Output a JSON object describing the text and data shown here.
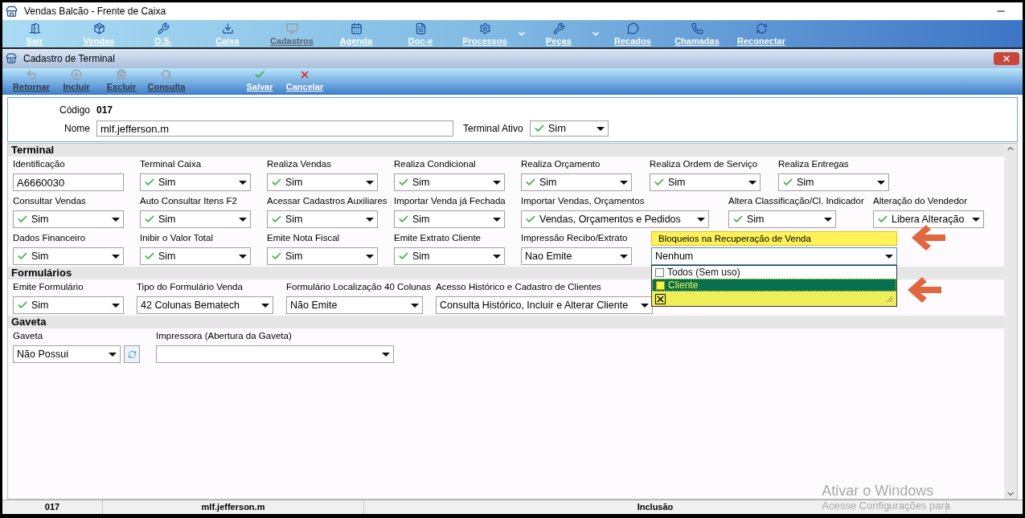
{
  "app": {
    "title": "Vendas Balcão - Frente de Caixa"
  },
  "main_toolbar": [
    {
      "label": "Sair",
      "disabled": false,
      "menu": false
    },
    {
      "label": "Vendas",
      "disabled": false,
      "menu": false
    },
    {
      "label": "O.S.",
      "disabled": false,
      "menu": false
    },
    {
      "label": "Caixa",
      "disabled": false,
      "menu": false
    },
    {
      "label": "Cadastros",
      "disabled": true,
      "menu": false
    },
    {
      "label": "Agenda",
      "disabled": false,
      "menu": false
    },
    {
      "label": "Doc-e",
      "disabled": false,
      "menu": false
    },
    {
      "label": "Processos",
      "disabled": false,
      "menu": true
    },
    {
      "label": "Peças",
      "disabled": false,
      "menu": true
    },
    {
      "label": "Recados",
      "disabled": false,
      "menu": false
    },
    {
      "label": "Chamadas",
      "disabled": false,
      "menu": false
    },
    {
      "label": "Reconectar",
      "disabled": false,
      "menu": false
    }
  ],
  "form_window": {
    "title": "Cadastro de Terminal"
  },
  "form_toolbar": [
    {
      "label": "Retornar",
      "disabled": true
    },
    {
      "label": "Incluir",
      "disabled": true
    },
    {
      "label": "Excluir",
      "disabled": true
    },
    {
      "label": "Consulta",
      "disabled": true
    },
    {
      "label": "Salvar",
      "disabled": false
    },
    {
      "label": "Cancelar",
      "disabled": false
    }
  ],
  "header": {
    "code_label": "Código",
    "code": "017",
    "name_label": "Nome",
    "name": "mlf.jefferson.m",
    "active_label": "Terminal Ativo",
    "active_value": "Sim",
    "active_check": true
  },
  "sections": [
    {
      "title": "Terminal",
      "rows": [
        [
          {
            "kind": "text",
            "label": "Identificação",
            "value": "A6660030"
          },
          {
            "kind": "select",
            "label": "Terminal Caixa",
            "value": "Sim",
            "check": true
          },
          {
            "kind": "select",
            "label": "Realiza Vendas",
            "value": "Sim",
            "check": true
          },
          {
            "kind": "select",
            "label": "Realiza Condicional",
            "value": "Sim",
            "check": true
          },
          {
            "kind": "select",
            "label": "Realiza Orçamento",
            "value": "Sim",
            "check": true
          },
          {
            "kind": "select",
            "label": "Realiza Ordem de Serviço",
            "value": "Sim",
            "check": true
          },
          {
            "kind": "select",
            "label": "Realiza Entregas",
            "value": "Sim",
            "check": true
          }
        ],
        [
          {
            "kind": "select",
            "label": "Consultar Vendas",
            "value": "Sim",
            "check": true
          },
          {
            "kind": "select",
            "label": "Auto Consultar Itens F2",
            "value": "Sim",
            "check": true
          },
          {
            "kind": "select",
            "label": "Acessar Cadastros Auxiliares",
            "value": "Sim",
            "check": true
          },
          {
            "kind": "select",
            "label": "Importar Venda já Fechada",
            "value": "Sim",
            "check": true
          },
          {
            "kind": "select",
            "label": "Importar Vendas, Orçamentos",
            "value": "Vendas, Orçamentos e Pedidos",
            "check": true
          },
          {
            "kind": "select",
            "label": "Altera Classificação/Cl. Indicador",
            "value": "Sim",
            "check": true
          },
          {
            "kind": "select",
            "label": "Alteração do Vendedor",
            "value": "Libera Alteração",
            "check": true
          }
        ],
        [
          {
            "kind": "select",
            "label": "Dados Financeiro",
            "value": "Sim",
            "check": true
          },
          {
            "kind": "select",
            "label": "Inibir o Valor Total",
            "value": "Sim",
            "check": true
          },
          {
            "kind": "select",
            "label": "Emite Nota Fiscal",
            "value": "Sim",
            "check": true
          },
          {
            "kind": "select",
            "label": "Emite Extrato Cliente",
            "value": "Sim",
            "check": true
          },
          {
            "kind": "select",
            "label": "Impressão Recibo/Extrato",
            "value": "Nao Emite",
            "check": false
          },
          {
            "kind": "multiselect",
            "label": "Bloqueios na Recuperação de Venda",
            "value": "Nenhum",
            "check": false,
            "highlighted": true,
            "expanded": true,
            "options": [
              {
                "label": "Todos (Sem uso)",
                "checked": false,
                "selected": false
              },
              {
                "label": "Cliente",
                "checked": false,
                "selected": true
              }
            ]
          }
        ]
      ]
    },
    {
      "title": "Formulários",
      "rows": [
        [
          {
            "kind": "select",
            "label": "Emite Formulário",
            "value": "Sim",
            "check": true
          },
          {
            "kind": "select",
            "label": "Tipo do Formulário Venda",
            "value": "42 Colunas Bematech",
            "check": false
          },
          {
            "kind": "select",
            "label": "Formulário Localização 40 Colunas",
            "value": "Não Emite",
            "check": false
          },
          {
            "kind": "select",
            "label": "Acesso Histórico e Cadastro de Clientes",
            "value": "Consulta Histórico, Incluir e Alterar Cliente",
            "check": false
          }
        ]
      ]
    },
    {
      "title": "Gaveta",
      "rows": [
        [
          {
            "kind": "select",
            "label": "Gaveta",
            "value": "Não Possui",
            "check": false,
            "button": true
          },
          {
            "kind": "select",
            "label": "Impressora (Abertura da Gaveta)",
            "check": false
          }
        ]
      ]
    }
  ],
  "status_bar": [
    "017",
    "mlf.jefferson.m",
    "Inclusão"
  ],
  "windows_activation": {
    "title": "Ativar o Windows",
    "text": "Acesse Configurações para"
  }
}
